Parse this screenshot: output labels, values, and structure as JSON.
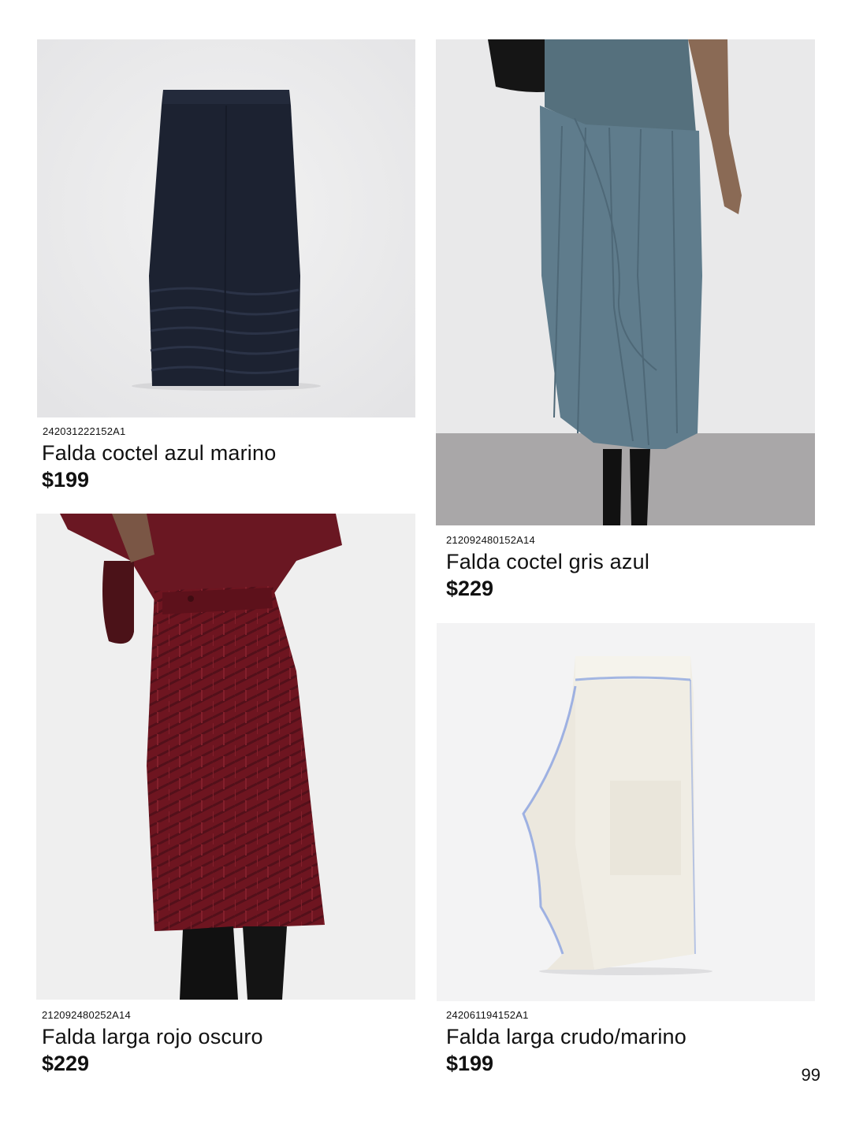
{
  "products": [
    {
      "sku": "242031222152A1",
      "name": "Falda coctel azul marino",
      "price": "$199",
      "image": "navy-knit-pencil-skirt"
    },
    {
      "sku": "212092480152A14",
      "name": "Falda coctel gris azul",
      "price": "$229",
      "image": "grey-blue-pleated-skirt"
    },
    {
      "sku": "212092480252A14",
      "name": "Falda larga rojo oscuro",
      "price": "$229",
      "image": "dark-red-textured-skirt"
    },
    {
      "sku": "242061194152A1",
      "name": "Falda larga crudo/marino",
      "price": "$199",
      "image": "ecru-navy-draped-skirt"
    }
  ],
  "page_number": "99",
  "colors": {
    "navy": "#1c2231",
    "grey_blue": "#5f7c8c",
    "dark_red": "#6e1520",
    "ecru": "#f0ede4",
    "trim_blue": "#8fa6e0"
  }
}
